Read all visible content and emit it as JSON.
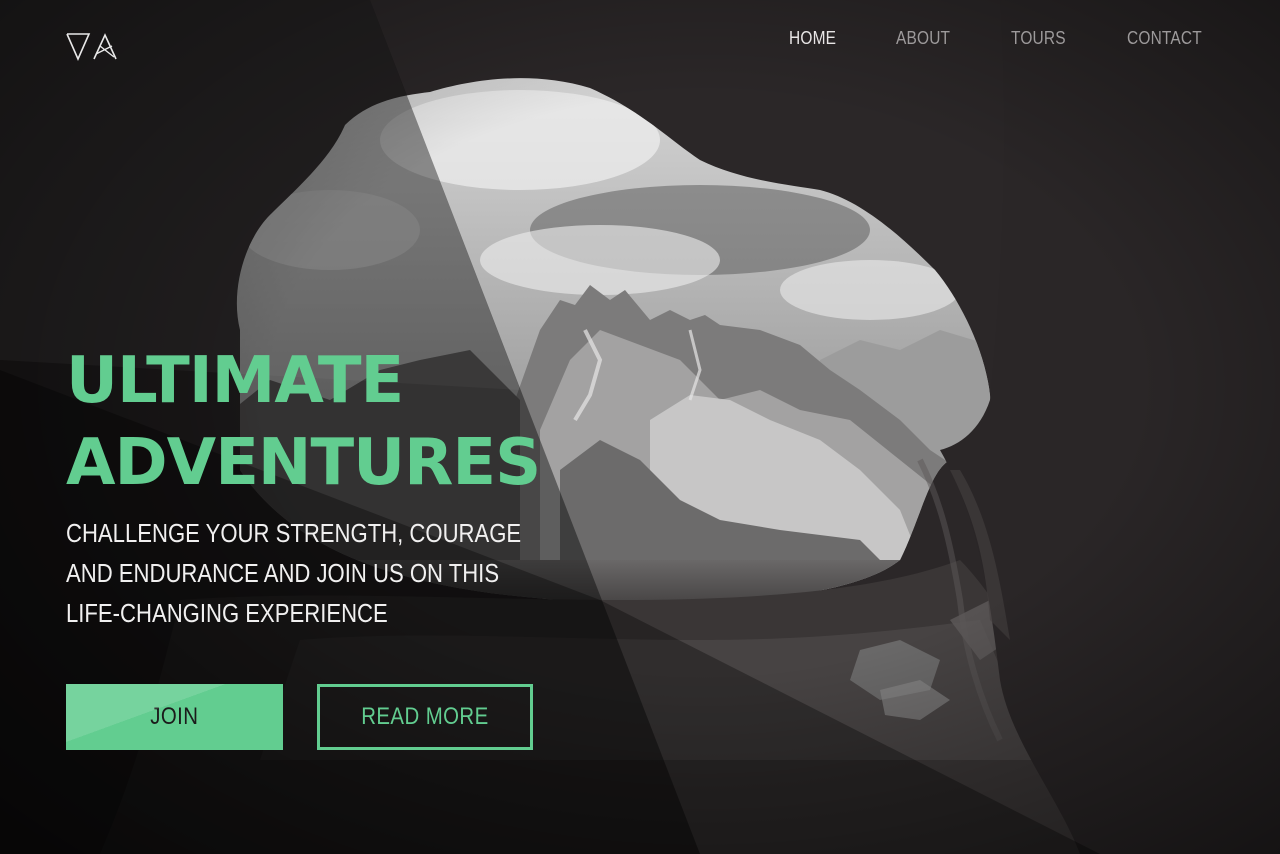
{
  "brand": {
    "logo_icon": "va-triangle-logo",
    "logo_text": "VA"
  },
  "nav": {
    "items": [
      {
        "label": "HOME",
        "active": true
      },
      {
        "label": "ABOUT",
        "active": false
      },
      {
        "label": "TOURS",
        "active": false
      },
      {
        "label": "CONTACT",
        "active": false
      }
    ]
  },
  "hero": {
    "title_line1": "ULTIMATE",
    "title_line2": "ADVENTURES",
    "subtitle_line1": "CHALLENGE YOUR STRENGTH, COURAGE",
    "subtitle_line2": "AND ENDURANCE AND JOIN US ON THIS",
    "subtitle_line3": "LIFE-CHANGING EXPERIENCE",
    "join_label": "JOIN",
    "read_more_label": "READ MORE",
    "background_image": "cave-mountain-view-photo"
  },
  "colors": {
    "accent": "#62cd90",
    "background": "#231f20",
    "text": "#f1f0f0",
    "nav_muted": "#9d9a9b",
    "nav_active": "#e8e6e6"
  }
}
